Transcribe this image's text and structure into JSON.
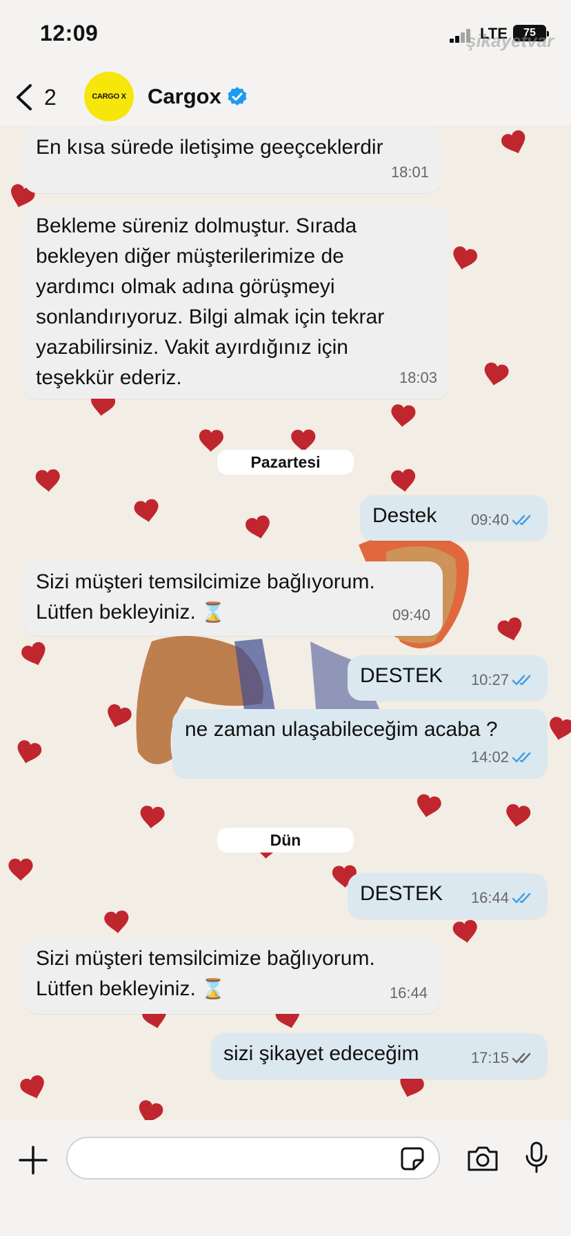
{
  "status_bar": {
    "time": "12:09",
    "network": "LTE",
    "battery": "75",
    "watermark": "şikayetvar"
  },
  "header": {
    "back_count": "2",
    "contact_name": "Cargox",
    "avatar_logo": "CARGO X",
    "verified": true
  },
  "messages": [
    {
      "direction": "in",
      "text": "En kısa sürede iletişime geeçceklerdir",
      "time": "18:01"
    },
    {
      "direction": "in",
      "text": "Bekleme süreniz dolmuştur. Sırada\nbekleyen diğer müşterilerimize de\nyardımcı olmak adına görüşmeyi\nsonlandırıyoruz. Bilgi almak için tekrar\nyazabilirsiniz. Vakit ayırdığınız için\nteşekkür ederiz.",
      "time": "18:03"
    },
    {
      "direction": "out",
      "text": "Destek",
      "time": "09:40",
      "status": "read"
    },
    {
      "direction": "in",
      "text_line1": "Sizi müşteri temsilcimize bağlıyorum.",
      "text_line2": "Lütfen bekleyiniz.",
      "icon": "hourglass-icon",
      "time": "09:40"
    },
    {
      "direction": "out",
      "text": "DESTEK",
      "time": "10:27",
      "status": "read"
    },
    {
      "direction": "out",
      "text": "ne zaman ulaşabileceğim acaba ?",
      "time": "14:02",
      "status": "read"
    },
    {
      "direction": "out",
      "text": "DESTEK",
      "time": "16:44",
      "status": "read"
    },
    {
      "direction": "in",
      "text_line1": "Sizi müşteri temsilcimize bağlıyorum.",
      "text_line2": "Lütfen bekleyiniz.",
      "icon": "hourglass-icon",
      "time": "16:44"
    },
    {
      "direction": "out",
      "text": "sizi şikayet edeceğim",
      "time": "17:15",
      "status": "delivered"
    }
  ],
  "day_separators": [
    "Pazartesi",
    "Dün"
  ],
  "input": {
    "placeholder": "",
    "value": ""
  },
  "colors": {
    "incoming_bubble": "#f0efef",
    "outgoing_bubble": "#dce8f0",
    "read_tick": "#4a9ee0",
    "delivered_tick": "#666666",
    "verified_badge": "#1d9bf0",
    "avatar_bg": "#f7e60b",
    "wallpaper": "#f2ede5",
    "heart": "#c0262e"
  }
}
